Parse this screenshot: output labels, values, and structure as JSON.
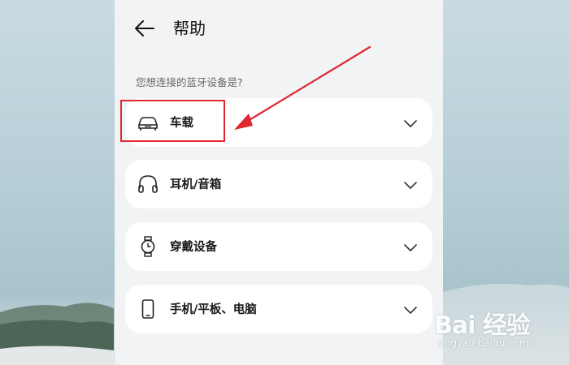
{
  "header": {
    "back_icon": "arrow-left-icon",
    "title": "帮助"
  },
  "question": "您想连接的蓝牙设备是?",
  "devices": [
    {
      "label": "车载",
      "icon": "car-icon"
    },
    {
      "label": "耳机/音箱",
      "icon": "headphones-icon"
    },
    {
      "label": "穿戴设备",
      "icon": "watch-icon"
    },
    {
      "label": "手机/平板、电脑",
      "icon": "phone-icon"
    }
  ],
  "watermark": {
    "logo": "Bai 经验",
    "url": "jingyan.baidu.com"
  },
  "colors": {
    "annotation": "#e0262e",
    "panel_bg": "#f1f3f5",
    "card_bg": "#ffffff"
  }
}
